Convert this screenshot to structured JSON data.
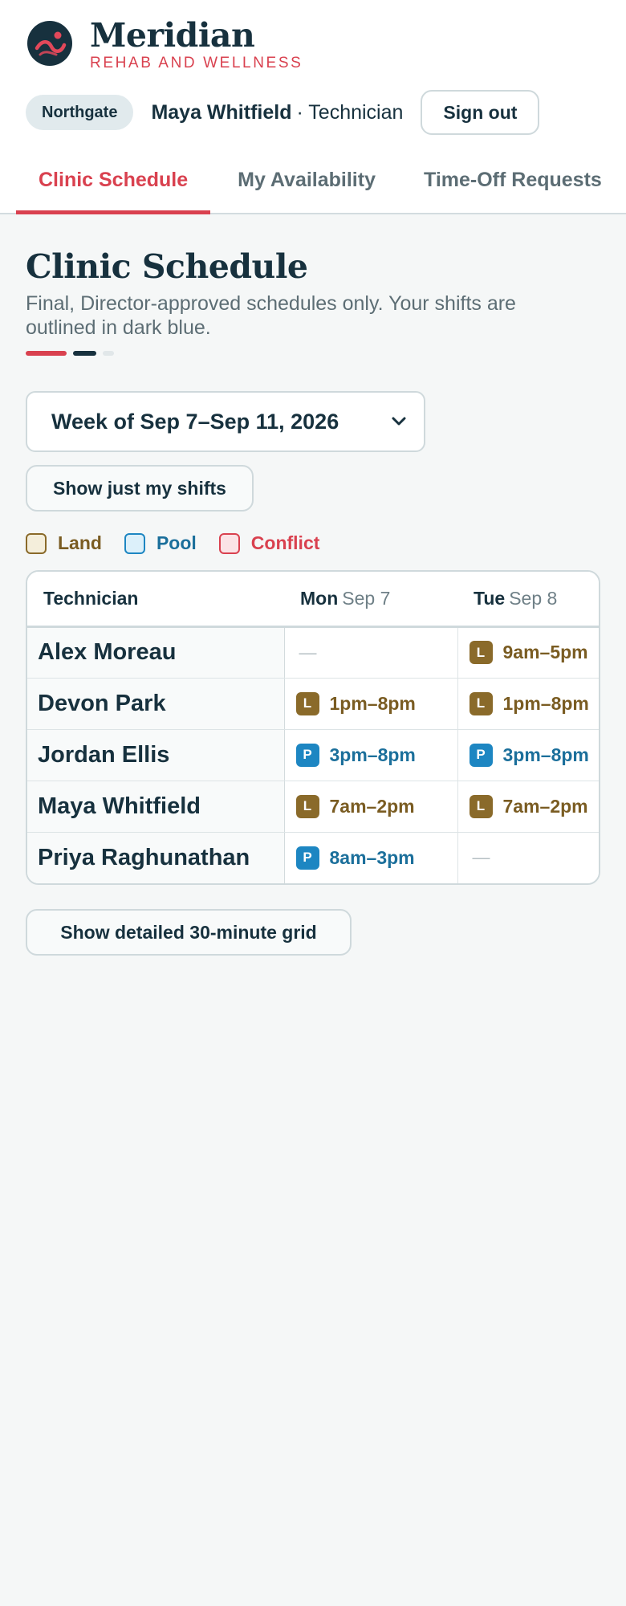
{
  "brand": {
    "name": "Meridian",
    "subtitle": "REHAB AND WELLNESS",
    "logo_icon": "wave-logo-icon"
  },
  "userbar": {
    "location": "Northgate",
    "user_name": "Maya Whitfield",
    "user_role": "· Technician",
    "sign_out_label": "Sign out"
  },
  "tabs": [
    {
      "label": "Clinic Schedule",
      "active": true
    },
    {
      "label": "My Availability",
      "active": false
    },
    {
      "label": "Time-Off Requests",
      "active": false
    }
  ],
  "page": {
    "title": "Clinic Schedule",
    "description": "Final, Director-approved schedules only. Your shifts are outlined in dark blue."
  },
  "week_select": {
    "selected": "Week of Sep 7–Sep 11, 2026",
    "icon": "chevron-down-icon"
  },
  "filter": {
    "my_shifts_label": "Show just my shifts"
  },
  "legend": [
    {
      "label": "Land",
      "key": "land"
    },
    {
      "label": "Pool",
      "key": "pool"
    },
    {
      "label": "Conflict",
      "key": "conflict"
    }
  ],
  "colors": {
    "accent": "#d9414f",
    "navy": "#17313e",
    "land": "#8a6a2a",
    "land_text": "#7a5c22",
    "land_bg": "#f4eedb",
    "pool": "#1d86c2",
    "pool_text": "#1b6f9b",
    "pool_bg": "#dcf0fa",
    "conflict": "#d9414f",
    "conflict_bg": "#fbe3e6"
  },
  "schedule": {
    "tech_header": "Technician",
    "days": [
      {
        "day": "Mon",
        "date": "Sep 7"
      },
      {
        "day": "Tue",
        "date": "Sep 8"
      }
    ],
    "empty_mark": "—",
    "rows": [
      {
        "name": "Alex Moreau",
        "shifts": [
          null,
          {
            "type": "land",
            "letter": "L",
            "time": "9am–5pm"
          }
        ]
      },
      {
        "name": "Devon Park",
        "shifts": [
          {
            "type": "land",
            "letter": "L",
            "time": "1pm–8pm"
          },
          {
            "type": "land",
            "letter": "L",
            "time": "1pm–8pm"
          }
        ]
      },
      {
        "name": "Jordan Ellis",
        "shifts": [
          {
            "type": "pool",
            "letter": "P",
            "time": "3pm–8pm"
          },
          {
            "type": "pool",
            "letter": "P",
            "time": "3pm–8pm"
          }
        ]
      },
      {
        "name": "Maya Whitfield",
        "shifts": [
          {
            "type": "land",
            "letter": "L",
            "time": "7am–2pm"
          },
          {
            "type": "land",
            "letter": "L",
            "time": "7am–2pm"
          }
        ]
      },
      {
        "name": "Priya Raghunathan",
        "shifts": [
          {
            "type": "pool",
            "letter": "P",
            "time": "8am–3pm"
          },
          null
        ]
      }
    ]
  },
  "detail_grid_label": "Show detailed 30-minute grid"
}
